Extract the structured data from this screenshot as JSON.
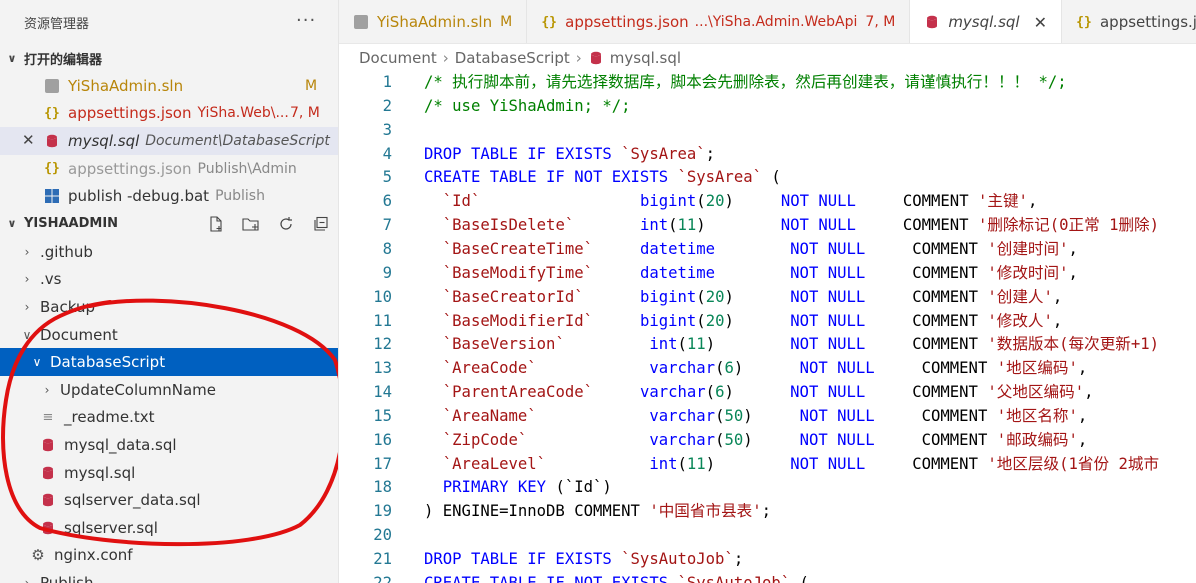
{
  "explorer": {
    "title": "资源管理器",
    "more_label": "···",
    "open_editors_header": "打开的编辑器",
    "open_editors": [
      {
        "name": "YiShaAdmin.sln",
        "desc": "",
        "badge": "M",
        "icon": "solution-icon",
        "state": "modified"
      },
      {
        "name": "appsettings.json",
        "desc": "YiSha.Web\\...",
        "badge": "7, M",
        "icon": "json-icon",
        "state": "error"
      },
      {
        "name": "mysql.sql",
        "desc": "Document\\DatabaseScript",
        "badge": "",
        "icon": "database-icon",
        "state": "active"
      },
      {
        "name": "appsettings.json",
        "desc": "Publish\\Admin",
        "badge": "",
        "icon": "json-icon",
        "state": "dim"
      },
      {
        "name": "publish -debug.bat",
        "desc": "Publish",
        "badge": "",
        "icon": "windows-icon",
        "state": "normal"
      }
    ],
    "workspace_header": "YISHAADMIN",
    "tree": [
      {
        "name": ".github",
        "kind": "folder",
        "depth": 1,
        "expanded": false
      },
      {
        "name": ".vs",
        "kind": "folder",
        "depth": 1,
        "expanded": false
      },
      {
        "name": "Backup",
        "kind": "folder",
        "depth": 1,
        "expanded": false
      },
      {
        "name": "Document",
        "kind": "folder",
        "depth": 1,
        "expanded": true
      },
      {
        "name": "DatabaseScript",
        "kind": "folder",
        "depth": 2,
        "expanded": true,
        "selected": true
      },
      {
        "name": "UpdateColumnName",
        "kind": "folder",
        "depth": 3,
        "expanded": false
      },
      {
        "name": "_readme.txt",
        "kind": "txt",
        "depth": 3
      },
      {
        "name": "mysql_data.sql",
        "kind": "sql",
        "depth": 3
      },
      {
        "name": "mysql.sql",
        "kind": "sql",
        "depth": 3
      },
      {
        "name": "sqlserver_data.sql",
        "kind": "sql",
        "depth": 3
      },
      {
        "name": "sqlserver.sql",
        "kind": "sql",
        "depth": 3
      },
      {
        "name": "nginx.conf",
        "kind": "conf",
        "depth": 2
      },
      {
        "name": "Publish",
        "kind": "folder",
        "depth": 1,
        "expanded": false
      }
    ]
  },
  "tabs": [
    {
      "name": "YiShaAdmin.sln",
      "desc": "",
      "badge": "M",
      "icon": "solution-icon",
      "active": false,
      "state": "modified"
    },
    {
      "name": "appsettings.json",
      "desc": "...\\YiSha.Admin.WebApi",
      "badge": "7, M",
      "icon": "json-icon",
      "active": false,
      "state": "error"
    },
    {
      "name": "mysql.sql",
      "desc": "",
      "badge": "",
      "icon": "database-icon",
      "active": true,
      "state": "active"
    },
    {
      "name": "appsettings.json",
      "desc": "",
      "badge": "",
      "icon": "json-icon",
      "active": false,
      "state": "normal"
    }
  ],
  "breadcrumb": [
    "Document",
    "DatabaseScript",
    "mysql.sql"
  ],
  "editor": {
    "lines": [
      {
        "n": "1",
        "t": [
          [
            "cm",
            "/* 执行脚本前，请先选择数据库，脚本会先删除表，然后再创建表，请谨慎执行！！！ */;"
          ]
        ]
      },
      {
        "n": "2",
        "t": [
          [
            "cm",
            "/* use YiShaAdmin; */;"
          ]
        ]
      },
      {
        "n": "3",
        "t": []
      },
      {
        "n": "4",
        "t": [
          [
            "kw",
            "DROP TABLE IF EXISTS "
          ],
          [
            "id",
            "`SysArea`"
          ],
          [
            "pl",
            ";"
          ]
        ]
      },
      {
        "n": "5",
        "t": [
          [
            "kw",
            "CREATE TABLE IF NOT EXISTS "
          ],
          [
            "id",
            "`SysArea`"
          ],
          [
            "pl",
            " ("
          ]
        ]
      },
      {
        "n": "6",
        "t": [
          [
            "pl",
            "  "
          ],
          [
            "id",
            "`Id`"
          ],
          [
            "pl",
            "                 "
          ],
          [
            "ty",
            "bigint"
          ],
          [
            "pl",
            "("
          ],
          [
            "num",
            "20"
          ],
          [
            "pl",
            ")     "
          ],
          [
            "kw",
            "NOT NULL"
          ],
          [
            "pl",
            "     COMMENT "
          ],
          [
            "str",
            "'主键'"
          ],
          [
            "pl",
            ","
          ]
        ]
      },
      {
        "n": "7",
        "t": [
          [
            "pl",
            "  "
          ],
          [
            "id",
            "`BaseIsDelete`"
          ],
          [
            "pl",
            "       "
          ],
          [
            "ty",
            "int"
          ],
          [
            "pl",
            "("
          ],
          [
            "num",
            "11"
          ],
          [
            "pl",
            ")        "
          ],
          [
            "kw",
            "NOT NULL"
          ],
          [
            "pl",
            "     COMMENT "
          ],
          [
            "str",
            "'删除标记(0正常 1删除)"
          ]
        ]
      },
      {
        "n": "8",
        "t": [
          [
            "pl",
            "  "
          ],
          [
            "id",
            "`BaseCreateTime`"
          ],
          [
            "pl",
            "     "
          ],
          [
            "ty",
            "datetime"
          ],
          [
            "pl",
            "        "
          ],
          [
            "kw",
            "NOT NULL"
          ],
          [
            "pl",
            "     COMMENT "
          ],
          [
            "str",
            "'创建时间'"
          ],
          [
            "pl",
            ","
          ]
        ]
      },
      {
        "n": "9",
        "t": [
          [
            "pl",
            "  "
          ],
          [
            "id",
            "`BaseModifyTime`"
          ],
          [
            "pl",
            "     "
          ],
          [
            "ty",
            "datetime"
          ],
          [
            "pl",
            "        "
          ],
          [
            "kw",
            "NOT NULL"
          ],
          [
            "pl",
            "     COMMENT "
          ],
          [
            "str",
            "'修改时间'"
          ],
          [
            "pl",
            ","
          ]
        ]
      },
      {
        "n": "10",
        "t": [
          [
            "pl",
            "  "
          ],
          [
            "id",
            "`BaseCreatorId`"
          ],
          [
            "pl",
            "      "
          ],
          [
            "ty",
            "bigint"
          ],
          [
            "pl",
            "("
          ],
          [
            "num",
            "20"
          ],
          [
            "pl",
            ")      "
          ],
          [
            "kw",
            "NOT NULL"
          ],
          [
            "pl",
            "     COMMENT "
          ],
          [
            "str",
            "'创建人'"
          ],
          [
            "pl",
            ","
          ]
        ]
      },
      {
        "n": "11",
        "t": [
          [
            "pl",
            "  "
          ],
          [
            "id",
            "`BaseModifierId`"
          ],
          [
            "pl",
            "     "
          ],
          [
            "ty",
            "bigint"
          ],
          [
            "pl",
            "("
          ],
          [
            "num",
            "20"
          ],
          [
            "pl",
            ")      "
          ],
          [
            "kw",
            "NOT NULL"
          ],
          [
            "pl",
            "     COMMENT "
          ],
          [
            "str",
            "'修改人'"
          ],
          [
            "pl",
            ","
          ]
        ]
      },
      {
        "n": "12",
        "t": [
          [
            "pl",
            "  "
          ],
          [
            "id",
            "`BaseVersion`"
          ],
          [
            "pl",
            "         "
          ],
          [
            "ty",
            "int"
          ],
          [
            "pl",
            "("
          ],
          [
            "num",
            "11"
          ],
          [
            "pl",
            ")        "
          ],
          [
            "kw",
            "NOT NULL"
          ],
          [
            "pl",
            "     COMMENT "
          ],
          [
            "str",
            "'数据版本(每次更新+1)"
          ]
        ]
      },
      {
        "n": "13",
        "t": [
          [
            "pl",
            "  "
          ],
          [
            "id",
            "`AreaCode`"
          ],
          [
            "pl",
            "            "
          ],
          [
            "ty",
            "varchar"
          ],
          [
            "pl",
            "("
          ],
          [
            "num",
            "6"
          ],
          [
            "pl",
            ")      "
          ],
          [
            "kw",
            "NOT NULL"
          ],
          [
            "pl",
            "     COMMENT "
          ],
          [
            "str",
            "'地区编码'"
          ],
          [
            "pl",
            ","
          ]
        ]
      },
      {
        "n": "14",
        "t": [
          [
            "pl",
            "  "
          ],
          [
            "id",
            "`ParentAreaCode`"
          ],
          [
            "pl",
            "     "
          ],
          [
            "ty",
            "varchar"
          ],
          [
            "pl",
            "("
          ],
          [
            "num",
            "6"
          ],
          [
            "pl",
            ")      "
          ],
          [
            "kw",
            "NOT NULL"
          ],
          [
            "pl",
            "     COMMENT "
          ],
          [
            "str",
            "'父地区编码'"
          ],
          [
            "pl",
            ","
          ]
        ]
      },
      {
        "n": "15",
        "t": [
          [
            "pl",
            "  "
          ],
          [
            "id",
            "`AreaName`"
          ],
          [
            "pl",
            "            "
          ],
          [
            "ty",
            "varchar"
          ],
          [
            "pl",
            "("
          ],
          [
            "num",
            "50"
          ],
          [
            "pl",
            ")     "
          ],
          [
            "kw",
            "NOT NULL"
          ],
          [
            "pl",
            "     COMMENT "
          ],
          [
            "str",
            "'地区名称'"
          ],
          [
            "pl",
            ","
          ]
        ]
      },
      {
        "n": "16",
        "t": [
          [
            "pl",
            "  "
          ],
          [
            "id",
            "`ZipCode`"
          ],
          [
            "pl",
            "             "
          ],
          [
            "ty",
            "varchar"
          ],
          [
            "pl",
            "("
          ],
          [
            "num",
            "50"
          ],
          [
            "pl",
            ")     "
          ],
          [
            "kw",
            "NOT NULL"
          ],
          [
            "pl",
            "     COMMENT "
          ],
          [
            "str",
            "'邮政编码'"
          ],
          [
            "pl",
            ","
          ]
        ]
      },
      {
        "n": "17",
        "t": [
          [
            "pl",
            "  "
          ],
          [
            "id",
            "`AreaLevel`"
          ],
          [
            "pl",
            "           "
          ],
          [
            "ty",
            "int"
          ],
          [
            "pl",
            "("
          ],
          [
            "num",
            "11"
          ],
          [
            "pl",
            ")        "
          ],
          [
            "kw",
            "NOT NULL"
          ],
          [
            "pl",
            "     COMMENT "
          ],
          [
            "str",
            "'地区层级(1省份 2城市"
          ]
        ]
      },
      {
        "n": "18",
        "t": [
          [
            "pl",
            "  "
          ],
          [
            "kw",
            "PRIMARY KEY"
          ],
          [
            "pl",
            " (`Id`)"
          ]
        ]
      },
      {
        "n": "19",
        "t": [
          [
            "pl",
            ") ENGINE=InnoDB COMMENT "
          ],
          [
            "str",
            "'中国省市县表'"
          ],
          [
            "pl",
            ";"
          ]
        ]
      },
      {
        "n": "20",
        "t": []
      },
      {
        "n": "21",
        "t": [
          [
            "kw",
            "DROP TABLE IF EXISTS "
          ],
          [
            "id",
            "`SysAutoJob`"
          ],
          [
            "pl",
            ";"
          ]
        ]
      },
      {
        "n": "22",
        "t": [
          [
            "kw",
            "CREATE TABLE IF NOT EXISTS "
          ],
          [
            "id",
            "`SysAutoJob`"
          ],
          [
            "pl",
            " ("
          ]
        ]
      }
    ]
  },
  "colors": {
    "selection": "#0060c0",
    "modified": "#b8860b",
    "error": "#c42b1c",
    "annotation": "#e01010"
  }
}
